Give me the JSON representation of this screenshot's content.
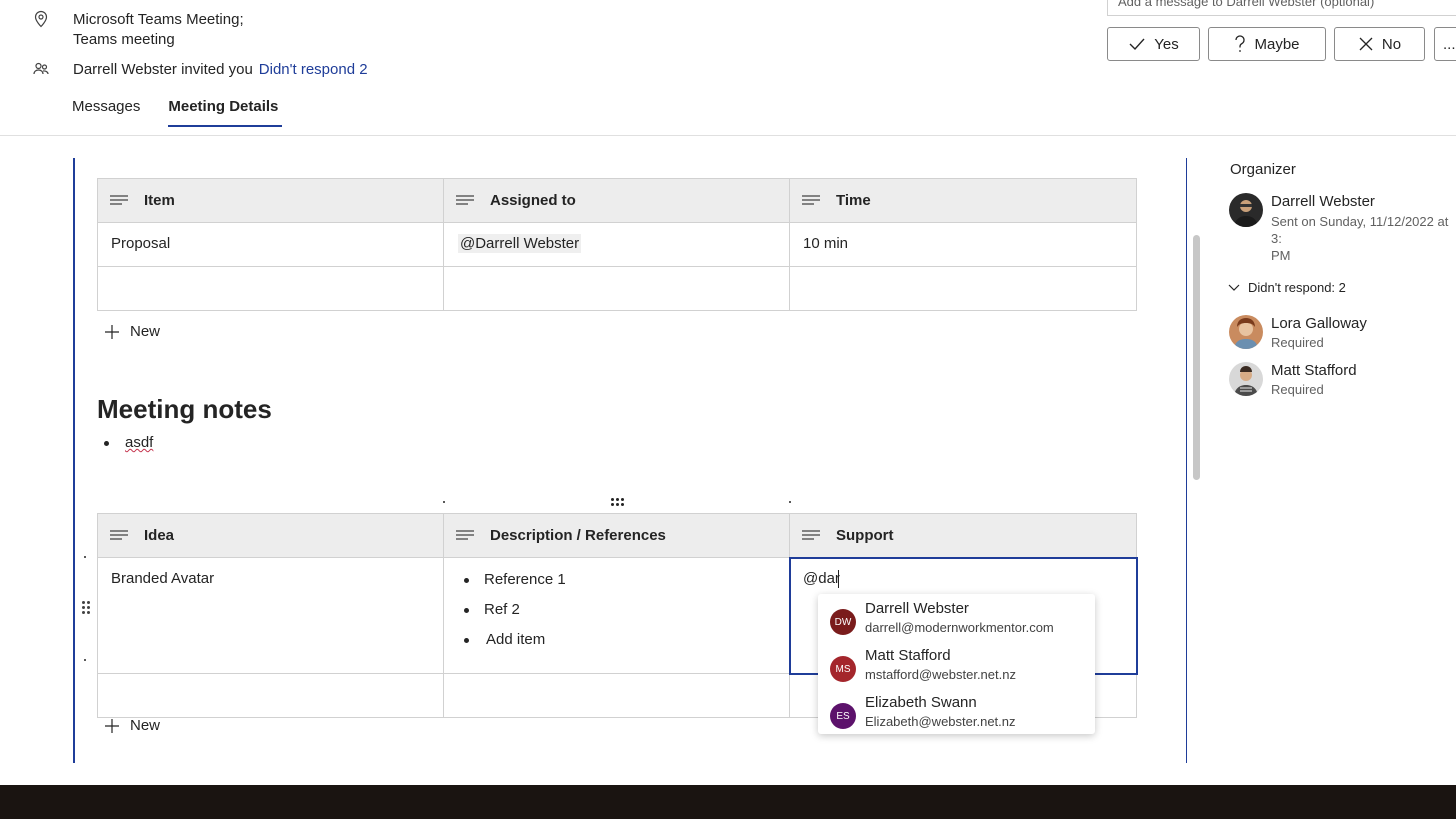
{
  "header": {
    "location_line1": "Microsoft Teams Meeting;",
    "location_line2": "Teams meeting",
    "inviter_text": "Darrell Webster invited you",
    "didnt_respond_link": "Didn't respond 2",
    "message_placeholder": "Add a message to Darrell Webster (optional)",
    "responses": {
      "yes": "Yes",
      "maybe": "Maybe",
      "no": "No",
      "more": "..."
    }
  },
  "tabs": [
    {
      "label": "Messages",
      "active": false
    },
    {
      "label": "Meeting Details",
      "active": true
    }
  ],
  "agenda_table": {
    "headers": [
      "Item",
      "Assigned to",
      "Time"
    ],
    "rows": [
      [
        "Proposal",
        "@Darrell Webster",
        "10 min"
      ],
      [
        "",
        "",
        ""
      ]
    ],
    "new_label": "New"
  },
  "meeting_notes": {
    "heading": "Meeting notes",
    "bullets": [
      "asdf"
    ]
  },
  "ideas_table": {
    "headers": [
      "Idea",
      "Description / References",
      "Support"
    ],
    "row1": {
      "idea": "Branded Avatar",
      "refs": [
        "Reference 1",
        "Ref 2"
      ],
      "add_item": "Add item",
      "support_input": "@dar"
    },
    "new_label": "New"
  },
  "mention_suggestions": [
    {
      "initials": "DW",
      "name": "Darrell Webster",
      "email": "darrell@modernworkmentor.com",
      "color": "#7a1c1c"
    },
    {
      "initials": "MS",
      "name": "Matt Stafford",
      "email": "mstafford@webster.net.nz",
      "color": "#a4262c"
    },
    {
      "initials": "ES",
      "name": "Elizabeth Swann",
      "email": "Elizabeth@webster.net.nz",
      "color": "#5c126b"
    }
  ],
  "right_panel": {
    "organizer_title": "Organizer",
    "organizer": {
      "name": "Darrell Webster",
      "sent_line1": "Sent on Sunday, 11/12/2022 at 3:",
      "sent_line2": "PM"
    },
    "didnt_respond_header": "Didn't respond: 2",
    "attendees": [
      {
        "name": "Lora Galloway",
        "role": "Required"
      },
      {
        "name": "Matt Stafford",
        "role": "Required"
      }
    ]
  },
  "colors": {
    "accent": "#1f3d99",
    "header_bg": "#ededed"
  }
}
